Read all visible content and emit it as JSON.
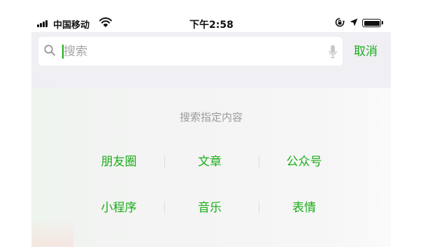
{
  "status_bar": {
    "carrier": "中国移动",
    "time": "下午2:58",
    "battery_level": 0.95
  },
  "search": {
    "placeholder": "搜索",
    "value": "",
    "cancel_label": "取消"
  },
  "hint": "搜索指定内容",
  "categories": [
    "朋友圈",
    "文章",
    "公众号",
    "小程序",
    "音乐",
    "表情"
  ],
  "colors": {
    "accent": "#1aad19",
    "hint_text": "#9b9b9b",
    "search_bar_bg": "#efeff4"
  },
  "icons": [
    "signal-bars-icon",
    "wifi-icon",
    "rotation-lock-icon",
    "location-arrow-icon",
    "battery-icon",
    "search-icon",
    "microphone-icon"
  ]
}
